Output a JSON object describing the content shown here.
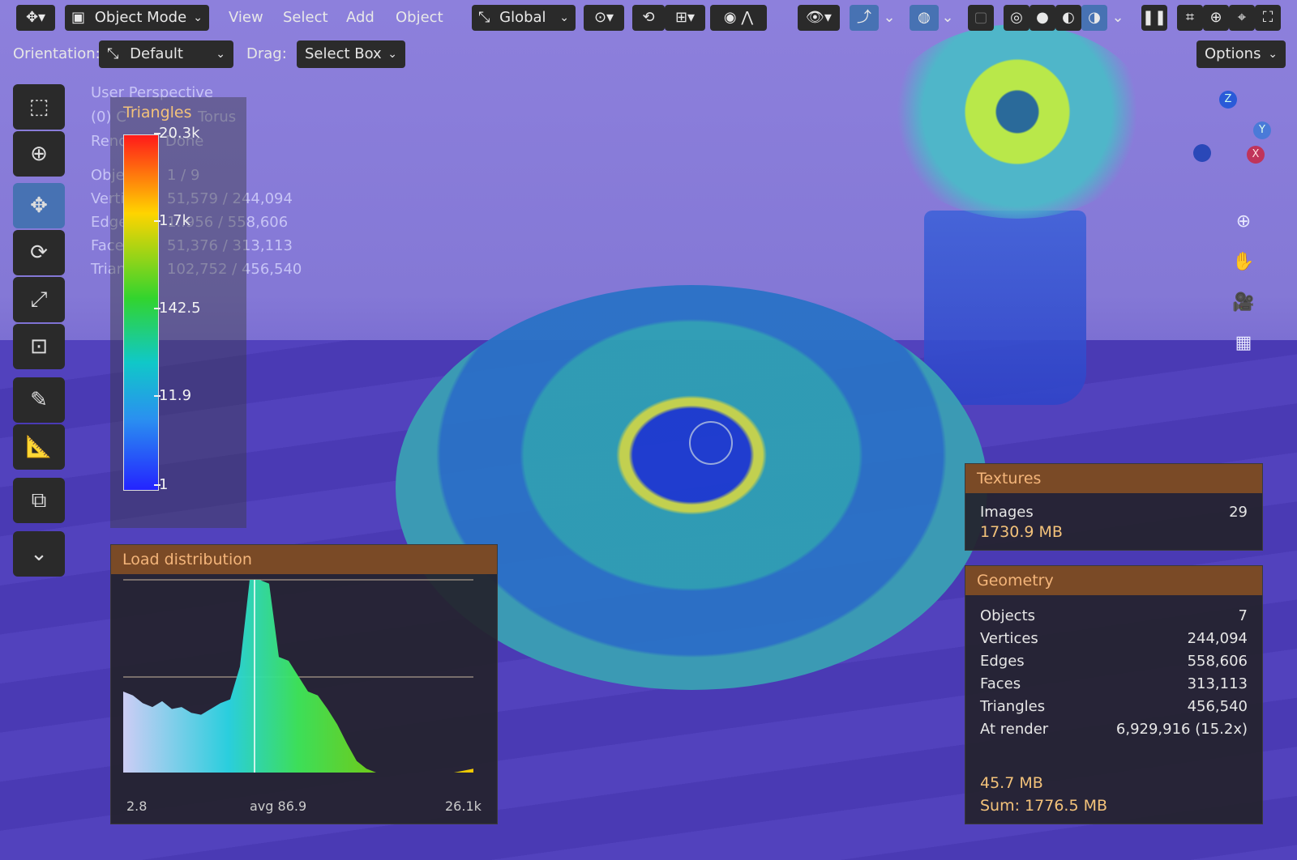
{
  "header": {
    "mode_label": "Object Mode",
    "menu_view": "View",
    "menu_select": "Select",
    "menu_add": "Add",
    "menu_object": "Object",
    "transform_orientation": "Global"
  },
  "tool_settings": {
    "orientation_label": "Orientation:",
    "orientation_value": "Default",
    "drag_label": "Drag:",
    "drag_value": "Select Box",
    "options_label": "Options"
  },
  "viewport_overlay": {
    "view_name": "User Perspective",
    "collection_line_prefix": "(0) C",
    "collection_line_suffix": "Torus",
    "render_label": "Rend",
    "render_value": "Done",
    "stats": [
      {
        "label": "Obje",
        "value": "1 / 9"
      },
      {
        "label": "Verti",
        "value": "51,579 / 244,094"
      },
      {
        "label": "Edge",
        "value": "1..956 / 558,606"
      },
      {
        "label": "Face",
        "value": "51,376 / 313,113"
      },
      {
        "label": "Trian",
        "value": "102,752 / 456,540"
      }
    ]
  },
  "legend": {
    "title": "Triangles",
    "ticks": [
      "20.3k",
      "1.7k",
      "142.5",
      "11.9",
      "1"
    ]
  },
  "load_distribution": {
    "title": "Load distribution",
    "min_label": "2.8",
    "avg_label": "avg 86.9",
    "max_label": "26.1k",
    "profile": [
      0.42,
      0.4,
      0.36,
      0.34,
      0.37,
      0.33,
      0.34,
      0.31,
      0.3,
      0.33,
      0.36,
      0.38,
      0.55,
      1.0,
      1.0,
      0.98,
      0.6,
      0.58,
      0.5,
      0.42,
      0.4,
      0.33,
      0.25,
      0.15,
      0.06,
      0.02,
      0.0,
      0.0,
      0.0,
      0.0,
      0.0,
      0.0,
      0.0,
      0.0,
      0.0,
      0.01,
      0.02
    ]
  },
  "textures_panel": {
    "title": "Textures",
    "images_label": "Images",
    "images_value": "29",
    "memory": "1730.9 MB"
  },
  "geometry_panel": {
    "title": "Geometry",
    "rows": [
      {
        "label": "Objects",
        "value": "7"
      },
      {
        "label": "Vertices",
        "value": "244,094"
      },
      {
        "label": "Edges",
        "value": "558,606"
      },
      {
        "label": "Faces",
        "value": "313,113"
      },
      {
        "label": "Triangles",
        "value": "456,540"
      },
      {
        "label": "At render",
        "value": "6,929,916  (15.2x)"
      }
    ],
    "memory": "45.7 MB",
    "sum": "Sum: 1776.5 MB"
  },
  "gizmo": {
    "axis_z": "Z",
    "axis_y": "Y",
    "axis_x": "X"
  },
  "colors": {
    "accent": "#4772b3",
    "panel_header": "#7a4a26",
    "panel_header_text": "#f4b57a",
    "value_highlight": "#f3c27a"
  }
}
